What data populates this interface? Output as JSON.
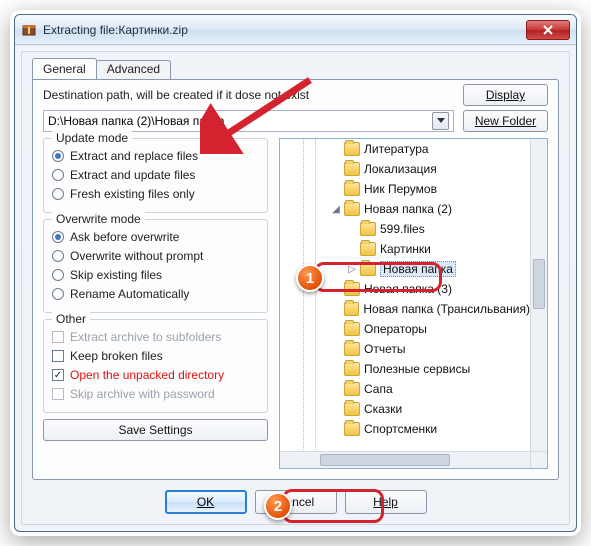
{
  "title": "Extracting file:Картинки.zip",
  "tabs": {
    "general": "General",
    "advanced": "Advanced"
  },
  "dest_label": "Destination path, will be created if it dose not exist",
  "dest_value": "D:\\Новая папка (2)\\Новая папка",
  "buttons": {
    "display": "Display",
    "new_folder": "New Folder",
    "save": "Save Settings",
    "ok": "OK",
    "cancel": "Cancel",
    "help": "Help"
  },
  "update_mode": {
    "legend": "Update mode",
    "options": [
      "Extract and replace files",
      "Extract and update files",
      "Fresh existing files only"
    ],
    "selected": 0
  },
  "overwrite_mode": {
    "legend": "Overwrite mode",
    "options": [
      "Ask before overwrite",
      "Overwrite without prompt",
      "Skip existing files",
      "Rename Automatically"
    ],
    "selected": 0
  },
  "other": {
    "legend": "Other",
    "items": [
      {
        "label": "Extract archive to subfolders",
        "checked": false,
        "disabled": true
      },
      {
        "label": "Keep broken files",
        "checked": false,
        "disabled": false
      },
      {
        "label": "Open the unpacked directory",
        "checked": true,
        "disabled": false,
        "red": true
      },
      {
        "label": "Skip archive with password",
        "checked": false,
        "disabled": true
      }
    ]
  },
  "tree": [
    {
      "depth": 2,
      "tw": "",
      "label": "Литература"
    },
    {
      "depth": 2,
      "tw": "",
      "label": "Локализация"
    },
    {
      "depth": 2,
      "tw": "",
      "label": "Ник Перумов"
    },
    {
      "depth": 2,
      "tw": "◢",
      "label": "Новая папка (2)"
    },
    {
      "depth": 3,
      "tw": "",
      "label": "599.files"
    },
    {
      "depth": 3,
      "tw": "",
      "label": "Картинки"
    },
    {
      "depth": 3,
      "tw": "▷",
      "label": "Новая папка",
      "selected": true
    },
    {
      "depth": 2,
      "tw": "",
      "label": "Новая папка (3)"
    },
    {
      "depth": 2,
      "tw": "",
      "label": "Новая папка (Трансильвания)"
    },
    {
      "depth": 2,
      "tw": "",
      "label": "Операторы"
    },
    {
      "depth": 2,
      "tw": "",
      "label": "Отчеты"
    },
    {
      "depth": 2,
      "tw": "",
      "label": "Полезные сервисы"
    },
    {
      "depth": 2,
      "tw": "",
      "label": "Сапа"
    },
    {
      "depth": 2,
      "tw": "",
      "label": "Сказки"
    },
    {
      "depth": 2,
      "tw": "",
      "label": "Спортсменки"
    }
  ]
}
